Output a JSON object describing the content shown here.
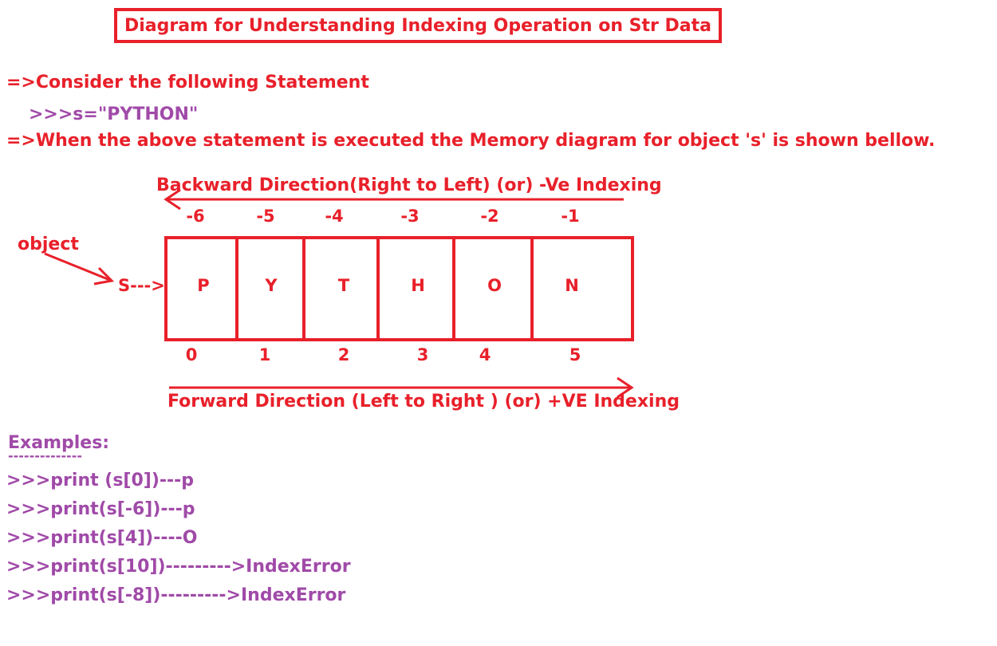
{
  "title": "Diagram for Understanding Indexing Operation on Str Data",
  "line1": "=>Consider the following Statement",
  "code": ">>>s=\"PYTHON\"",
  "line2": "=>When the above statement is executed the Memory diagram for object 's' is shown bellow.",
  "backward_label": "Backward Direction(Right to Left) (or) -Ve Indexing",
  "forward_label": "Forward Direction (Left to Right ) (or) +VE Indexing",
  "object_label": "object",
  "pointer_label": "S--->",
  "cells": [
    "P",
    "Y",
    "T",
    "H",
    "O",
    "N"
  ],
  "neg_indices": [
    "-6",
    "-5",
    "-4",
    "-3",
    "-2",
    "-1"
  ],
  "pos_indices": [
    "0",
    "1",
    "2",
    "3",
    "4",
    "5"
  ],
  "examples_heading": "Examples:",
  "examples_underline": "--------------",
  "examples": [
    ">>>print (s[0])---p",
    ">>>print(s[-6])---p",
    ">>>print(s[4])----O",
    ">>>print(s[10])--------->IndexError",
    ">>>print(s[-8])--------->IndexError"
  ],
  "colors": {
    "accent": "#e8202a",
    "code": "#a04aa8"
  }
}
